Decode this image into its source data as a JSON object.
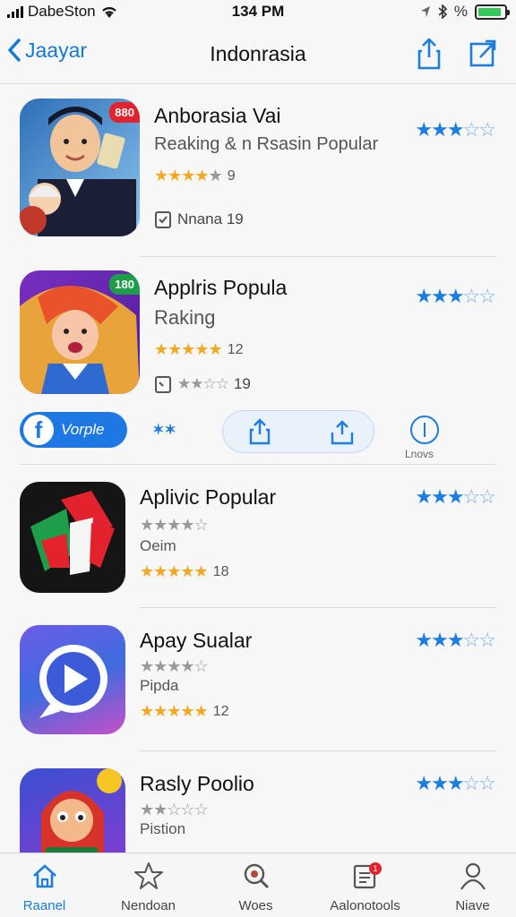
{
  "status": {
    "carrier": "DabeSton",
    "time": "134 PM",
    "battery_pct": "%",
    "battery_level": 0.9
  },
  "nav": {
    "back_label": "Jaayar",
    "title": "Indonrasia"
  },
  "apps": [
    {
      "name": "Anborasia Vai",
      "subtitle": "Reaking & n Rsasin Popular",
      "rating_count": "9",
      "meta": "Nnana 19",
      "badge": "880",
      "right_rating": 3,
      "left_rating": 4
    },
    {
      "name": "Applris Popula",
      "subtitle": "Raking",
      "rating_count": "12",
      "meta": "19",
      "badge": "180",
      "right_rating": 3,
      "left_rating": 5
    },
    {
      "name": "Aplivic Popular",
      "subtitle": "Oeim",
      "rating_count": "18",
      "right_rating": 3,
      "left_rating": 5
    },
    {
      "name": "Apay Sualar",
      "subtitle": "Pipda",
      "rating_count": "12",
      "right_rating": 3,
      "left_rating": 5
    },
    {
      "name": "Rasly Poolio",
      "subtitle": "Pistion",
      "right_rating": 3
    }
  ],
  "actionbar": {
    "fb_label": "Vorple",
    "info_label": "Lnovs"
  },
  "tabs": [
    {
      "label": "Raanel",
      "icon": "home-icon",
      "active": true
    },
    {
      "label": "Nendoan",
      "icon": "star-icon"
    },
    {
      "label": "Woes",
      "icon": "search-icon"
    },
    {
      "label": "Aalonotools",
      "icon": "updates-icon",
      "badge": "1"
    },
    {
      "label": "Niave",
      "icon": "person-icon"
    }
  ],
  "colors": {
    "accent": "#1b7ee0",
    "star_gold": "#f3a81f",
    "badge_red": "#e2232e"
  }
}
